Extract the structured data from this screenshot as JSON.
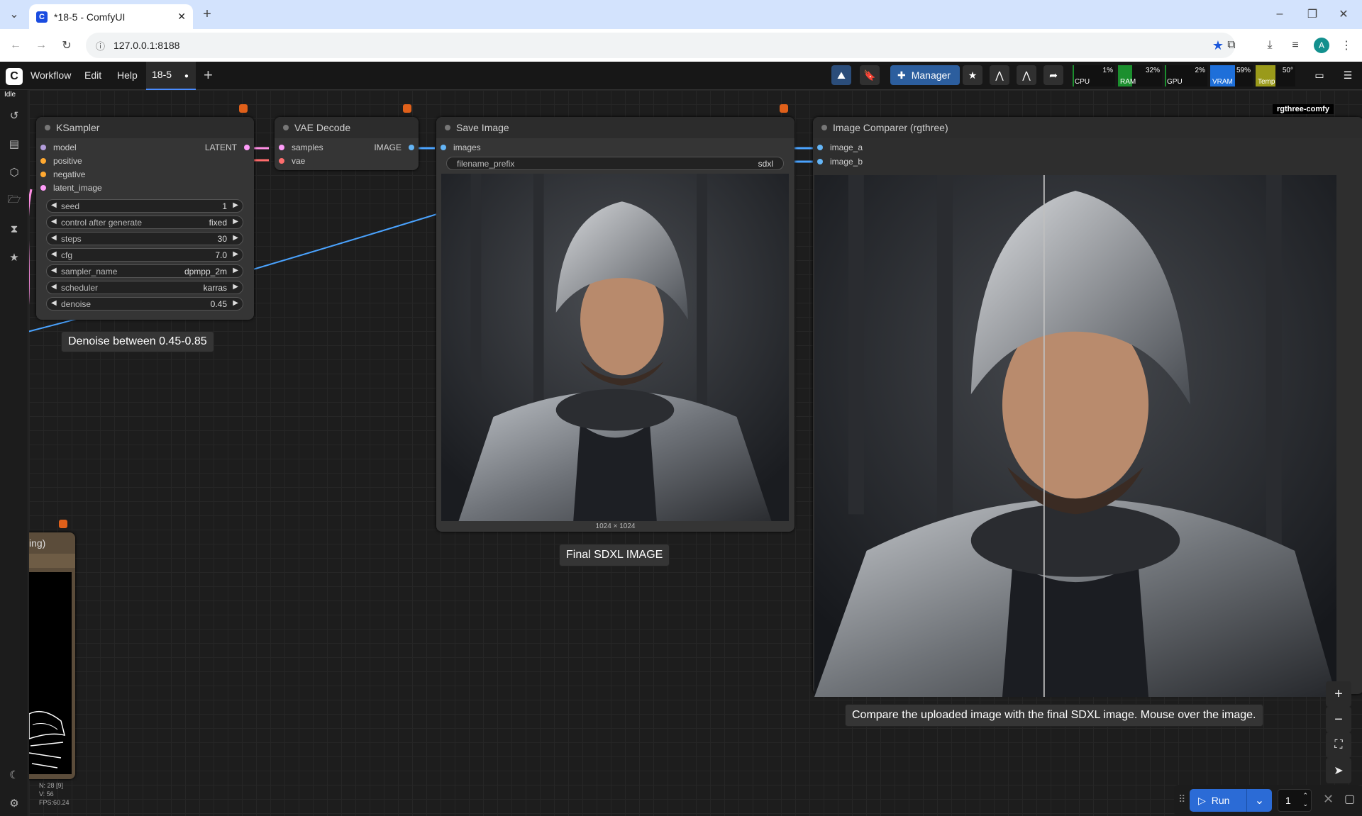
{
  "browser": {
    "tab_title": "*18-5 - ComfyUI",
    "favicon": "C",
    "url": "127.0.0.1:8188",
    "profile_initial": "A"
  },
  "menu": {
    "workflow": "Workflow",
    "edit": "Edit",
    "help": "Help",
    "workflow_tab": "18-5",
    "workflow_tab_modified": "●",
    "manager": "Manager",
    "status": "Idle"
  },
  "monitor": {
    "cpu": {
      "label": "CPU",
      "value": "1%",
      "fill": 0.01,
      "color": "#1b8f2e"
    },
    "ram": {
      "label": "RAM",
      "value": "32%",
      "fill": 0.32,
      "color": "#1b8f2e"
    },
    "gpu": {
      "label": "GPU",
      "value": "2%",
      "fill": 0.02,
      "color": "#1b8f2e"
    },
    "vram": {
      "label": "VRAM",
      "value": "59%",
      "fill": 0.59,
      "color": "#1e6fd9"
    },
    "temp": {
      "label": "Temp",
      "value": "50°",
      "fill": 0.5,
      "color": "#9a9a1a"
    }
  },
  "ksampler": {
    "title": "KSampler",
    "inputs": [
      "model",
      "positive",
      "negative",
      "latent_image"
    ],
    "output": "LATENT",
    "widgets": [
      {
        "name": "seed",
        "value": "1"
      },
      {
        "name": "control after generate",
        "value": "fixed"
      },
      {
        "name": "steps",
        "value": "30"
      },
      {
        "name": "cfg",
        "value": "7.0"
      },
      {
        "name": "sampler_name",
        "value": "dpmpp_2m"
      },
      {
        "name": "scheduler",
        "value": "karras"
      },
      {
        "name": "denoise",
        "value": "0.45"
      }
    ]
  },
  "vae_decode": {
    "title": "VAE Decode",
    "inputs": [
      "samples",
      "vae"
    ],
    "output": "IMAGE"
  },
  "save_image": {
    "title": "Save Image",
    "input": "images",
    "widget_name": "filename_prefix",
    "widget_value": "sdxl",
    "size_label": "1024 × 1024"
  },
  "comparer": {
    "title": "Image Comparer (rgthree)",
    "inputs": [
      "image_a",
      "image_b"
    ],
    "badge": "rgthree-comfy"
  },
  "partial_node": {
    "title": "ing)"
  },
  "notes": {
    "denoise": "Denoise between 0.45-0.85",
    "final": "Final SDXL IMAGE",
    "compare": "Compare the uploaded image with the final SDXL image. Mouse over the image."
  },
  "stats": {
    "n": "N: 28 [9]",
    "v": "V: 56",
    "fps": "FPS:60.24"
  },
  "run": {
    "label": "Run",
    "count": "1"
  },
  "icons": [
    "history-icon",
    "queue-icon",
    "model-library-icon",
    "workflows-icon",
    "node-library-icon",
    "templates-icon",
    "theme-icon",
    "settings-icon"
  ]
}
